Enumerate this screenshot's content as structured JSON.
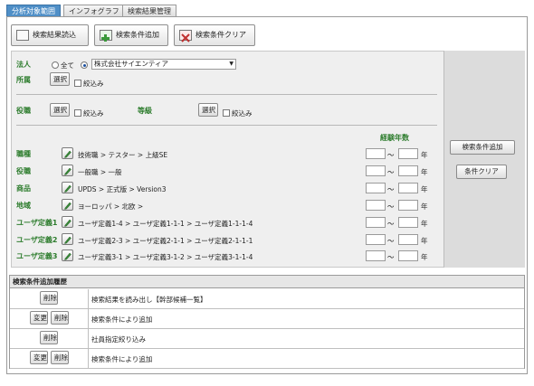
{
  "tabs": [
    {
      "label": "分析対象範囲",
      "active": true
    },
    {
      "label": "インフォグラフ",
      "active": false
    },
    {
      "label": "検索結果管理",
      "active": false
    }
  ],
  "toolbar": {
    "load_label": "検索結果読込",
    "add_label": "検索条件追加",
    "clear_label": "検索条件クリア"
  },
  "filters": {
    "corp_label": "法人",
    "radio_all": "全て",
    "corp_select": "株式会社サイエンティア",
    "dept_label": "所属",
    "select_btn": "選択",
    "narrow_label": "絞込み",
    "role_label": "役職",
    "grade_label": "等級"
  },
  "experience_header": "経験年数",
  "tilde": "～",
  "year_unit": "年",
  "criteria": [
    {
      "label": "職種",
      "value": "技術職 > テスター > 上級SE"
    },
    {
      "label": "役職",
      "value": "一般職 > 一般"
    },
    {
      "label": "商品",
      "value": "UPDS > 正式版 > Version3"
    },
    {
      "label": "地域",
      "value": "ヨーロッパ > 北欧 >"
    },
    {
      "label": "ユーザ定義1",
      "value": "ユーザ定義1-4 > ユーザ定義1-1-1 > ユーザ定義1-1-1-4"
    },
    {
      "label": "ユーザ定義2",
      "value": "ユーザ定義2-3 > ユーザ定義2-1-1 > ユーザ定義2-1-1-1"
    },
    {
      "label": "ユーザ定義3",
      "value": "ユーザ定義3-1 > ユーザ定義3-1-2 > ユーザ定義3-1-1-4"
    }
  ],
  "side": {
    "add_btn": "検索条件追加",
    "clear_btn": "条件クリア"
  },
  "history": {
    "title": "検索条件追加履歴",
    "change_btn": "変更",
    "delete_btn": "削除",
    "rows": [
      {
        "text": "検索結果を読み出し【幹部候補一覧】",
        "has_change": false
      },
      {
        "text": "検索条件により追加",
        "has_change": true
      },
      {
        "text": "社員指定絞り込み",
        "has_change": false
      },
      {
        "text": "検索条件により追加",
        "has_change": true
      }
    ]
  },
  "colors": {
    "label_green": "#2e7d2e",
    "tab_active": "#4f8fc7"
  }
}
